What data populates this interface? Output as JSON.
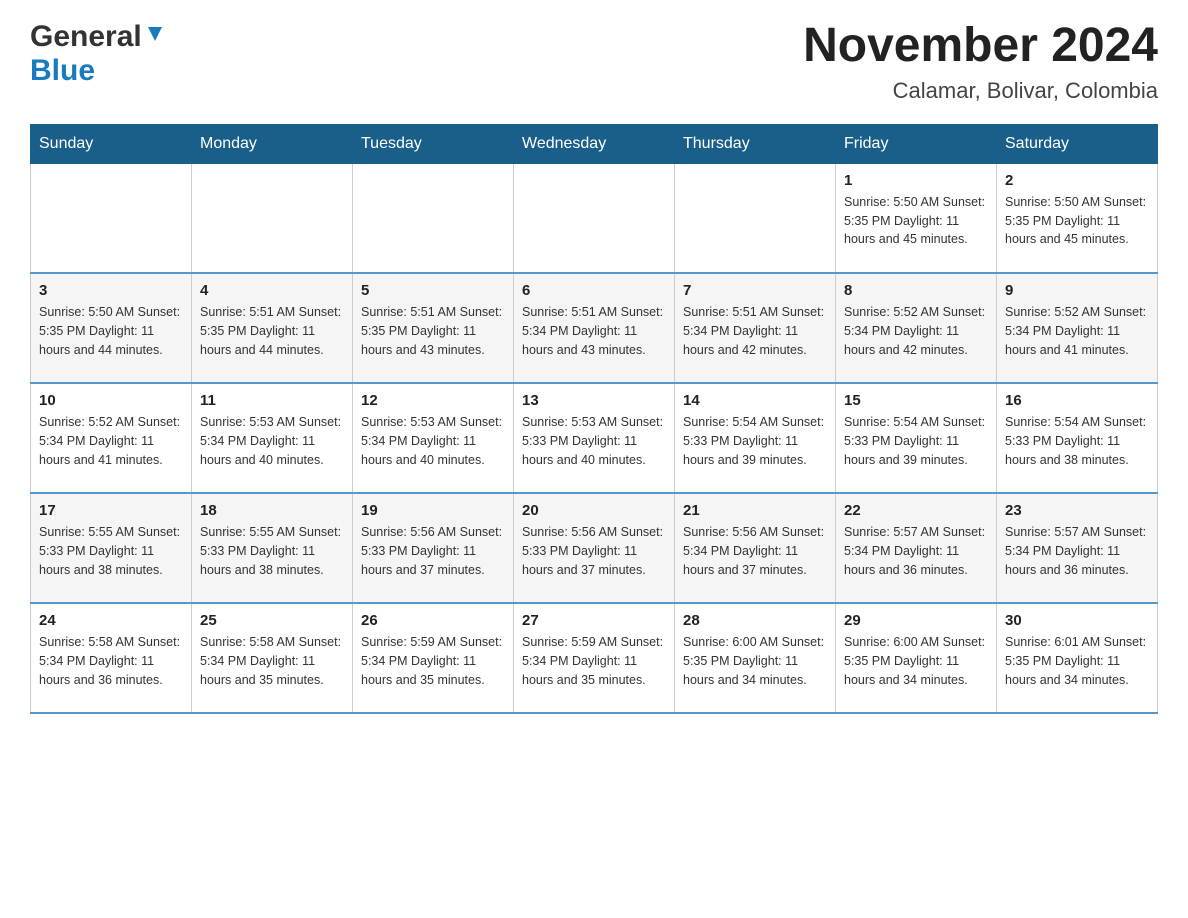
{
  "header": {
    "logo_general": "General",
    "logo_blue": "Blue",
    "title": "November 2024",
    "subtitle": "Calamar, Bolivar, Colombia"
  },
  "weekdays": [
    "Sunday",
    "Monday",
    "Tuesday",
    "Wednesday",
    "Thursday",
    "Friday",
    "Saturday"
  ],
  "weeks": [
    {
      "days": [
        {
          "date": "",
          "info": ""
        },
        {
          "date": "",
          "info": ""
        },
        {
          "date": "",
          "info": ""
        },
        {
          "date": "",
          "info": ""
        },
        {
          "date": "",
          "info": ""
        },
        {
          "date": "1",
          "info": "Sunrise: 5:50 AM\nSunset: 5:35 PM\nDaylight: 11 hours\nand 45 minutes."
        },
        {
          "date": "2",
          "info": "Sunrise: 5:50 AM\nSunset: 5:35 PM\nDaylight: 11 hours\nand 45 minutes."
        }
      ]
    },
    {
      "days": [
        {
          "date": "3",
          "info": "Sunrise: 5:50 AM\nSunset: 5:35 PM\nDaylight: 11 hours\nand 44 minutes."
        },
        {
          "date": "4",
          "info": "Sunrise: 5:51 AM\nSunset: 5:35 PM\nDaylight: 11 hours\nand 44 minutes."
        },
        {
          "date": "5",
          "info": "Sunrise: 5:51 AM\nSunset: 5:35 PM\nDaylight: 11 hours\nand 43 minutes."
        },
        {
          "date": "6",
          "info": "Sunrise: 5:51 AM\nSunset: 5:34 PM\nDaylight: 11 hours\nand 43 minutes."
        },
        {
          "date": "7",
          "info": "Sunrise: 5:51 AM\nSunset: 5:34 PM\nDaylight: 11 hours\nand 42 minutes."
        },
        {
          "date": "8",
          "info": "Sunrise: 5:52 AM\nSunset: 5:34 PM\nDaylight: 11 hours\nand 42 minutes."
        },
        {
          "date": "9",
          "info": "Sunrise: 5:52 AM\nSunset: 5:34 PM\nDaylight: 11 hours\nand 41 minutes."
        }
      ]
    },
    {
      "days": [
        {
          "date": "10",
          "info": "Sunrise: 5:52 AM\nSunset: 5:34 PM\nDaylight: 11 hours\nand 41 minutes."
        },
        {
          "date": "11",
          "info": "Sunrise: 5:53 AM\nSunset: 5:34 PM\nDaylight: 11 hours\nand 40 minutes."
        },
        {
          "date": "12",
          "info": "Sunrise: 5:53 AM\nSunset: 5:34 PM\nDaylight: 11 hours\nand 40 minutes."
        },
        {
          "date": "13",
          "info": "Sunrise: 5:53 AM\nSunset: 5:33 PM\nDaylight: 11 hours\nand 40 minutes."
        },
        {
          "date": "14",
          "info": "Sunrise: 5:54 AM\nSunset: 5:33 PM\nDaylight: 11 hours\nand 39 minutes."
        },
        {
          "date": "15",
          "info": "Sunrise: 5:54 AM\nSunset: 5:33 PM\nDaylight: 11 hours\nand 39 minutes."
        },
        {
          "date": "16",
          "info": "Sunrise: 5:54 AM\nSunset: 5:33 PM\nDaylight: 11 hours\nand 38 minutes."
        }
      ]
    },
    {
      "days": [
        {
          "date": "17",
          "info": "Sunrise: 5:55 AM\nSunset: 5:33 PM\nDaylight: 11 hours\nand 38 minutes."
        },
        {
          "date": "18",
          "info": "Sunrise: 5:55 AM\nSunset: 5:33 PM\nDaylight: 11 hours\nand 38 minutes."
        },
        {
          "date": "19",
          "info": "Sunrise: 5:56 AM\nSunset: 5:33 PM\nDaylight: 11 hours\nand 37 minutes."
        },
        {
          "date": "20",
          "info": "Sunrise: 5:56 AM\nSunset: 5:33 PM\nDaylight: 11 hours\nand 37 minutes."
        },
        {
          "date": "21",
          "info": "Sunrise: 5:56 AM\nSunset: 5:34 PM\nDaylight: 11 hours\nand 37 minutes."
        },
        {
          "date": "22",
          "info": "Sunrise: 5:57 AM\nSunset: 5:34 PM\nDaylight: 11 hours\nand 36 minutes."
        },
        {
          "date": "23",
          "info": "Sunrise: 5:57 AM\nSunset: 5:34 PM\nDaylight: 11 hours\nand 36 minutes."
        }
      ]
    },
    {
      "days": [
        {
          "date": "24",
          "info": "Sunrise: 5:58 AM\nSunset: 5:34 PM\nDaylight: 11 hours\nand 36 minutes."
        },
        {
          "date": "25",
          "info": "Sunrise: 5:58 AM\nSunset: 5:34 PM\nDaylight: 11 hours\nand 35 minutes."
        },
        {
          "date": "26",
          "info": "Sunrise: 5:59 AM\nSunset: 5:34 PM\nDaylight: 11 hours\nand 35 minutes."
        },
        {
          "date": "27",
          "info": "Sunrise: 5:59 AM\nSunset: 5:34 PM\nDaylight: 11 hours\nand 35 minutes."
        },
        {
          "date": "28",
          "info": "Sunrise: 6:00 AM\nSunset: 5:35 PM\nDaylight: 11 hours\nand 34 minutes."
        },
        {
          "date": "29",
          "info": "Sunrise: 6:00 AM\nSunset: 5:35 PM\nDaylight: 11 hours\nand 34 minutes."
        },
        {
          "date": "30",
          "info": "Sunrise: 6:01 AM\nSunset: 5:35 PM\nDaylight: 11 hours\nand 34 minutes."
        }
      ]
    }
  ]
}
